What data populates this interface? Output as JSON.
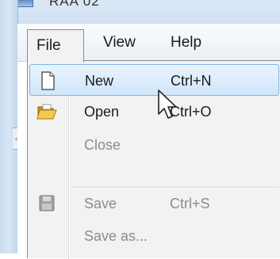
{
  "window": {
    "title": "RAA 02"
  },
  "menubar": {
    "items": [
      {
        "label": "File",
        "open": true
      },
      {
        "label": "View"
      },
      {
        "label": "Help"
      }
    ]
  },
  "file_menu": {
    "items": [
      {
        "label": "New",
        "shortcut": "Ctrl+N",
        "icon": "new-document-icon",
        "highlighted": true,
        "enabled": true
      },
      {
        "label": "Open",
        "shortcut": "Ctrl+O",
        "icon": "open-folder-icon",
        "enabled": true
      },
      {
        "label": "Close",
        "shortcut": "",
        "icon": "",
        "enabled": false
      },
      {
        "label": "Save",
        "shortcut": "Ctrl+S",
        "icon": "save-disk-icon",
        "enabled": false
      },
      {
        "label": "Save as...",
        "shortcut": "",
        "icon": "",
        "enabled": false
      }
    ]
  },
  "colors": {
    "highlight_border": "#7fb4e6",
    "highlight_fill": "#cfe5fa",
    "menu_background": "#f2f2f2",
    "disabled_text": "#8c8c8c",
    "folder_yellow": "#e8b93a"
  }
}
